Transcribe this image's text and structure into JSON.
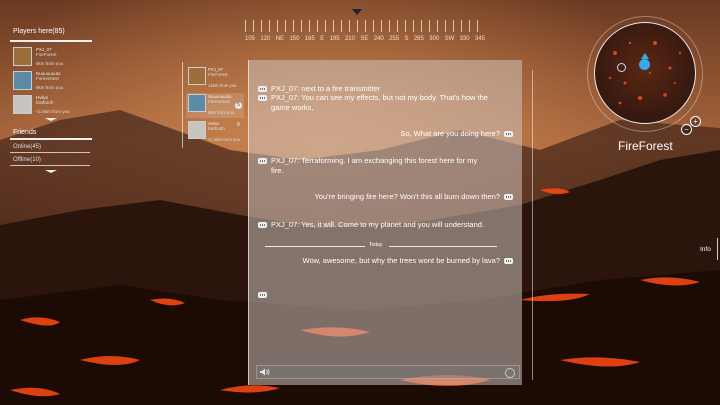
{
  "compass": {
    "labels": [
      "105",
      "120",
      "NE",
      "150",
      "165",
      "E",
      "195",
      "210",
      "SE",
      "240",
      "255",
      "S",
      "285",
      "300",
      "SW",
      "330",
      "345"
    ]
  },
  "players": {
    "title": "Players here(85)",
    "list": [
      {
        "name": "PXJ_07",
        "status": "FireForest",
        "distance": "5km from you",
        "color": "#9c6f3a"
      },
      {
        "name": "Nuuuuuuuto",
        "status": "Forevertest",
        "distance": "6km from you",
        "color": "#5a8caa"
      },
      {
        "name": "Hvilys",
        "status": "EatEarth",
        "distance": "<1.5km from you",
        "color": "#c8c4c0"
      }
    ]
  },
  "friends": {
    "title": "Friends",
    "online": "Online(45)",
    "offline": "Offline(10)"
  },
  "contacts": [
    {
      "name": "PXJ_07",
      "status": "FireForest",
      "distance": "12km from you",
      "badge": "",
      "color": "#9c6f3a"
    },
    {
      "name": "Nuuuuuuuto",
      "status": "Forevertest",
      "distance": "6km from you",
      "badge": "5",
      "color": "#5a8caa"
    },
    {
      "name": "Hvilys",
      "status": "EatEarth",
      "distance": "<1.5km from you",
      "badge": "8",
      "color": "#c8c4c0"
    }
  ],
  "chat": {
    "messages": [
      {
        "side": "in",
        "text": "PXJ_07: next to a fire transmitter"
      },
      {
        "side": "in",
        "text": "PXJ_07: You can see my effects, but not my body. That's how the game works,"
      },
      {
        "side": "out",
        "text": "So, What are you doing here?"
      },
      {
        "side": "in",
        "text": "PXJ_07: Terraforming. I am exchanging this forest here for my fire."
      },
      {
        "side": "out",
        "text": "You're bringing fire here? Won't this all burn down then?"
      },
      {
        "side": "in",
        "text": "PXJ_07: Yes, it will. Come to my planet and you will understand."
      },
      {
        "side": "out",
        "text": "Wow, awesome, but why the trees wont be burned by lava?"
      }
    ],
    "today_label": "Today"
  },
  "minimap": {
    "location": "FireForest",
    "zoom_in": "+",
    "zoom_out": "−"
  },
  "info": {
    "label": "Info"
  },
  "colors": {
    "panel": "#cdc1ba",
    "accent": "#39a7e8",
    "lava": "#ff4a14"
  }
}
